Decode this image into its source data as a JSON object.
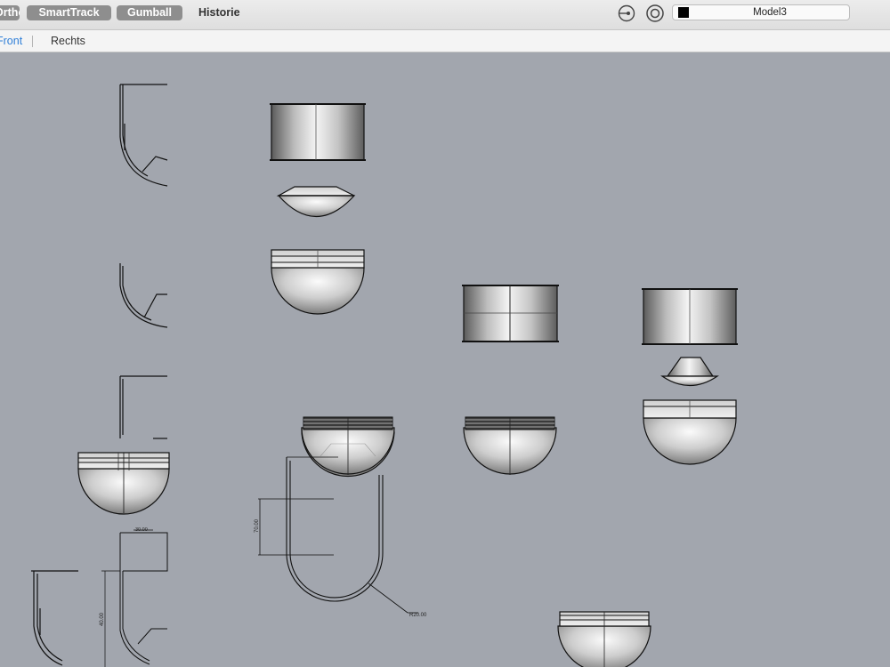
{
  "toolbar": {
    "ortho_label": "Ortho",
    "smarttrack_label": "SmartTrack",
    "gumball_label": "Gumball",
    "history_label": "Historie",
    "layer_name": "Model3",
    "layer_color": "#000000",
    "snap_icon": "planar-snap-icon",
    "osnap_icon": "osnap-target-icon"
  },
  "viewport_tabs": {
    "front_label": "Front",
    "right_label": "Rechts",
    "active_color": "#2f7fd8"
  },
  "viewport": {
    "background": "#a2a6ae",
    "dimension_height": "70.00",
    "dimension_radius": "R20.00",
    "dimension_left": "40.00",
    "dimension_top": "30.00"
  }
}
